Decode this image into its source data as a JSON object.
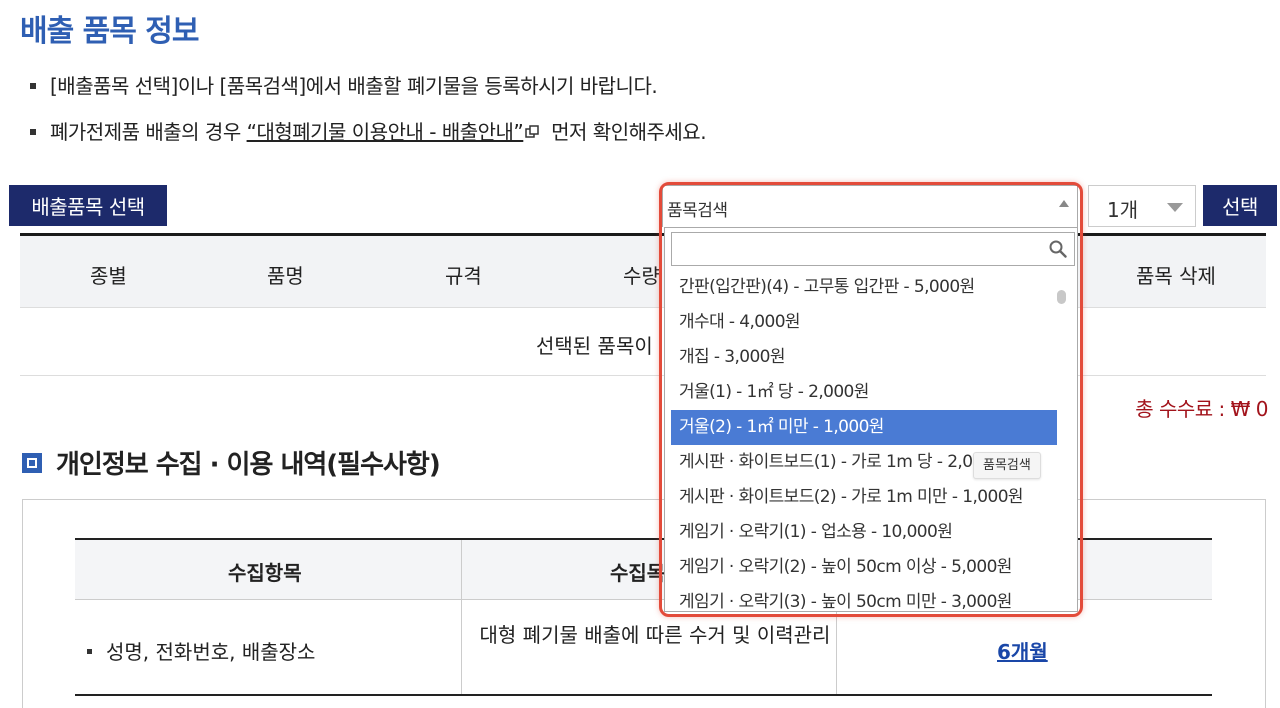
{
  "page": {
    "title": "배출 품목 정보",
    "notices": [
      {
        "text": "[배출품목 선택]이나 [품목검색]에서 배출할 폐기물을 등록하시기 바랍니다."
      },
      {
        "prefix": "폐가전제품 배출의 경우 ",
        "link": "“대형폐기물 이용안내 - 배출안내”",
        "suffix": " 먼저 확인해주세요."
      }
    ]
  },
  "toolbar": {
    "select_item_button": "배출품목 선택",
    "search_select_value": "품목검색",
    "qty_value": "1개",
    "choose_button": "선택"
  },
  "items_table": {
    "headers": [
      "종별",
      "품명",
      "규격",
      "수량",
      "품목 삭제"
    ],
    "empty_message": "선택된 품목이"
  },
  "total_fee": "총 수수료 : ₩ 0",
  "dropdown": {
    "search_placeholder": "",
    "options": [
      "간판(입간판)(4) - 고무통 입간판 - 5,000원",
      "개수대 - 4,000원",
      "개집 - 3,000원",
      "거울(1) - 1㎡ 당 - 2,000원",
      "거울(2) - 1㎡ 미만 - 1,000원",
      "게시판 · 화이트보드(1) - 가로 1m 당 - 2,000원",
      "게시판 · 화이트보드(2) - 가로 1m 미만 - 1,000원",
      "게임기 · 오락기(1) - 업소용 - 10,000원",
      "게임기 · 오락기(2) - 높이 50cm 이상 - 5,000원",
      "게임기 · 오락기(3) - 높이 50cm 미만 - 3,000원"
    ],
    "active_index": 4,
    "tooltip": "품목검색"
  },
  "privacy": {
    "section_title": "개인정보 수집 · 이용 내역(필수사항)",
    "headers": [
      "수집항목",
      "수집목"
    ],
    "row": {
      "items": "성명, 전화번호, 배출장소",
      "purpose": "대형 폐기물 배출에 따른 수거 및 이력관리",
      "period": "6개월"
    }
  },
  "colors": {
    "title_blue": "#2f5fb3",
    "navy_button": "#1d2a6b",
    "active_option": "#4a7bd4",
    "total_red": "#a2131b",
    "highlight": "#e34b3a"
  }
}
